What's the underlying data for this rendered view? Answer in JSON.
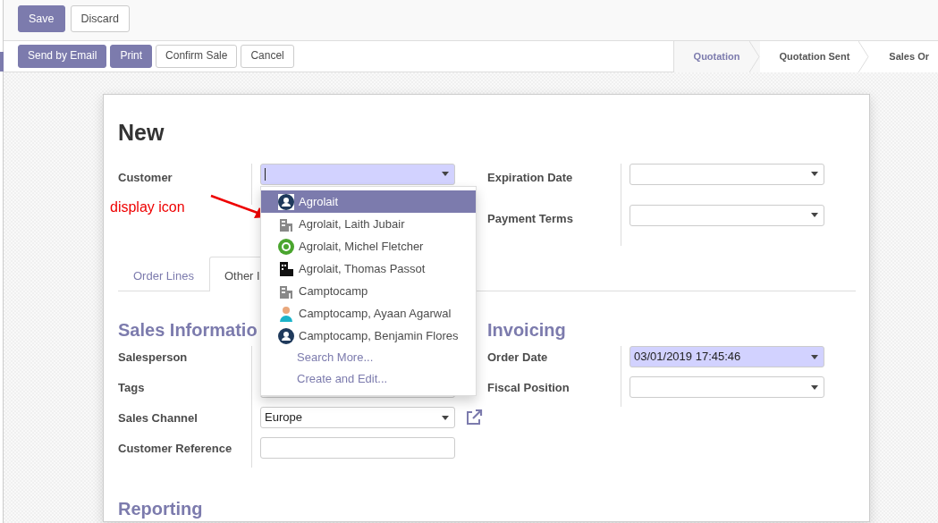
{
  "control_panel": {
    "buttons": [
      {
        "label": "Save",
        "kind": "primary"
      },
      {
        "label": "Discard",
        "kind": "secondary"
      }
    ]
  },
  "status_bar": {
    "buttons": [
      {
        "label": "Send by Email",
        "kind": "primary"
      },
      {
        "label": "Print",
        "kind": "primary"
      },
      {
        "label": "Confirm Sale",
        "kind": "secondary"
      },
      {
        "label": "Cancel",
        "kind": "secondary"
      }
    ],
    "stages": [
      {
        "label": "Quotation",
        "selected": true
      },
      {
        "label": "Quotation Sent",
        "selected": false
      },
      {
        "label": "Sales Or",
        "selected": false
      }
    ]
  },
  "sheet": {
    "title": "New",
    "top_left": [
      {
        "label": "Customer",
        "kind": "select",
        "highlighted": true,
        "cursor": true
      }
    ],
    "top_right": [
      {
        "label": "Expiration Date",
        "kind": "select",
        "highlighted": false
      },
      {
        "label": "Payment Terms",
        "kind": "select",
        "highlighted": false
      }
    ],
    "tabs": [
      {
        "label": "Order Lines",
        "selected": false
      },
      {
        "label": "Other I",
        "selected": true
      }
    ],
    "sections": [
      {
        "title": "Sales Informatio",
        "fields": [
          {
            "label": "Salesperson",
            "kind": "hidden"
          },
          {
            "label": "Tags",
            "kind": "select",
            "highlighted": false
          },
          {
            "label": "Sales Channel",
            "kind": "select",
            "value": "Europe",
            "highlighted": false,
            "external_link": true
          },
          {
            "label": "Customer Reference",
            "kind": "text",
            "highlighted": false
          }
        ]
      },
      {
        "title": "Invoicing",
        "fields": [
          {
            "label": "Order Date",
            "kind": "select",
            "value": "03/01/2019 17:45:46",
            "highlighted": true
          },
          {
            "label": "Fiscal Position",
            "kind": "select",
            "highlighted": false
          }
        ]
      },
      {
        "title": "Reporting"
      }
    ]
  },
  "annotation": {
    "text": "display icon"
  },
  "dropdown": {
    "items": [
      {
        "label": "Agrolait",
        "kind": "contact",
        "selected": true
      },
      {
        "label": "Agrolait, Laith Jubair",
        "kind": "company",
        "selected": false
      },
      {
        "label": "Agrolait, Michel Fletcher",
        "kind": "chat",
        "selected": false
      },
      {
        "label": "Agrolait, Thomas Passot",
        "kind": "office",
        "selected": false
      },
      {
        "label": "Camptocamp",
        "kind": "company",
        "selected": false
      },
      {
        "label": "Camptocamp, Ayaan Agarwal",
        "kind": "person",
        "selected": false
      },
      {
        "label": "Camptocamp, Benjamin Flores",
        "kind": "contact",
        "selected": false
      }
    ],
    "links": [
      "Search More...",
      "Create and Edit..."
    ]
  }
}
